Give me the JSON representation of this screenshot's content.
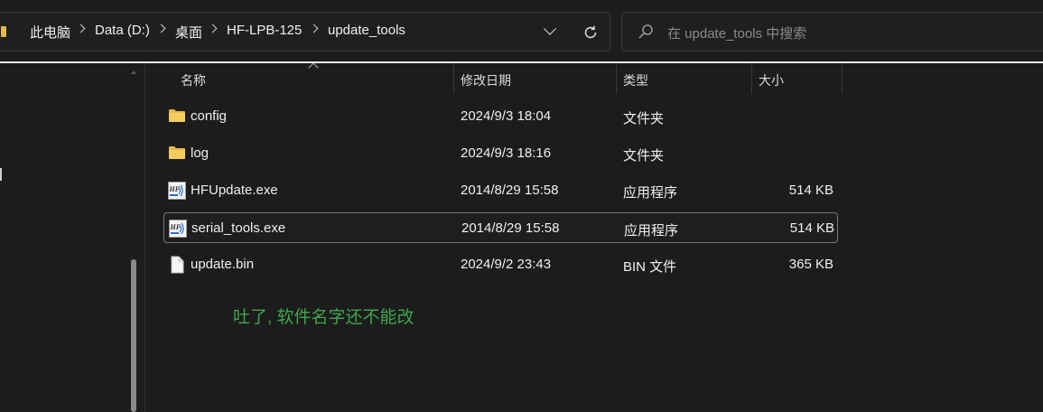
{
  "breadcrumb": [
    "此电脑",
    "Data (D:)",
    "桌面",
    "HF-LPB-125",
    "update_tools"
  ],
  "search": {
    "placeholder": "在 update_tools 中搜索"
  },
  "columns": {
    "name": "名称",
    "modified": "修改日期",
    "type": "类型",
    "size": "大小"
  },
  "files": [
    {
      "name": "config",
      "modified": "2024/9/3 18:04",
      "type": "文件夹",
      "size": "",
      "icon": "folder-icon"
    },
    {
      "name": "log",
      "modified": "2024/9/3 18:16",
      "type": "文件夹",
      "size": "",
      "icon": "folder-icon"
    },
    {
      "name": "HFUpdate.exe",
      "modified": "2014/8/29 15:58",
      "type": "应用程序",
      "size": "514 KB",
      "icon": "hf-app-icon"
    },
    {
      "name": "serial_tools.exe",
      "modified": "2014/8/29 15:58",
      "type": "应用程序",
      "size": "514 KB",
      "icon": "hf-app-icon",
      "selected": true
    },
    {
      "name": "update.bin",
      "modified": "2024/9/2 23:43",
      "type": "BIN 文件",
      "size": "365 KB",
      "icon": "file-icon"
    }
  ],
  "annotation": "吐了, 软件名字还不能改",
  "colors": {
    "annotation": "#3fa64b",
    "folder": "#e8b84a"
  }
}
